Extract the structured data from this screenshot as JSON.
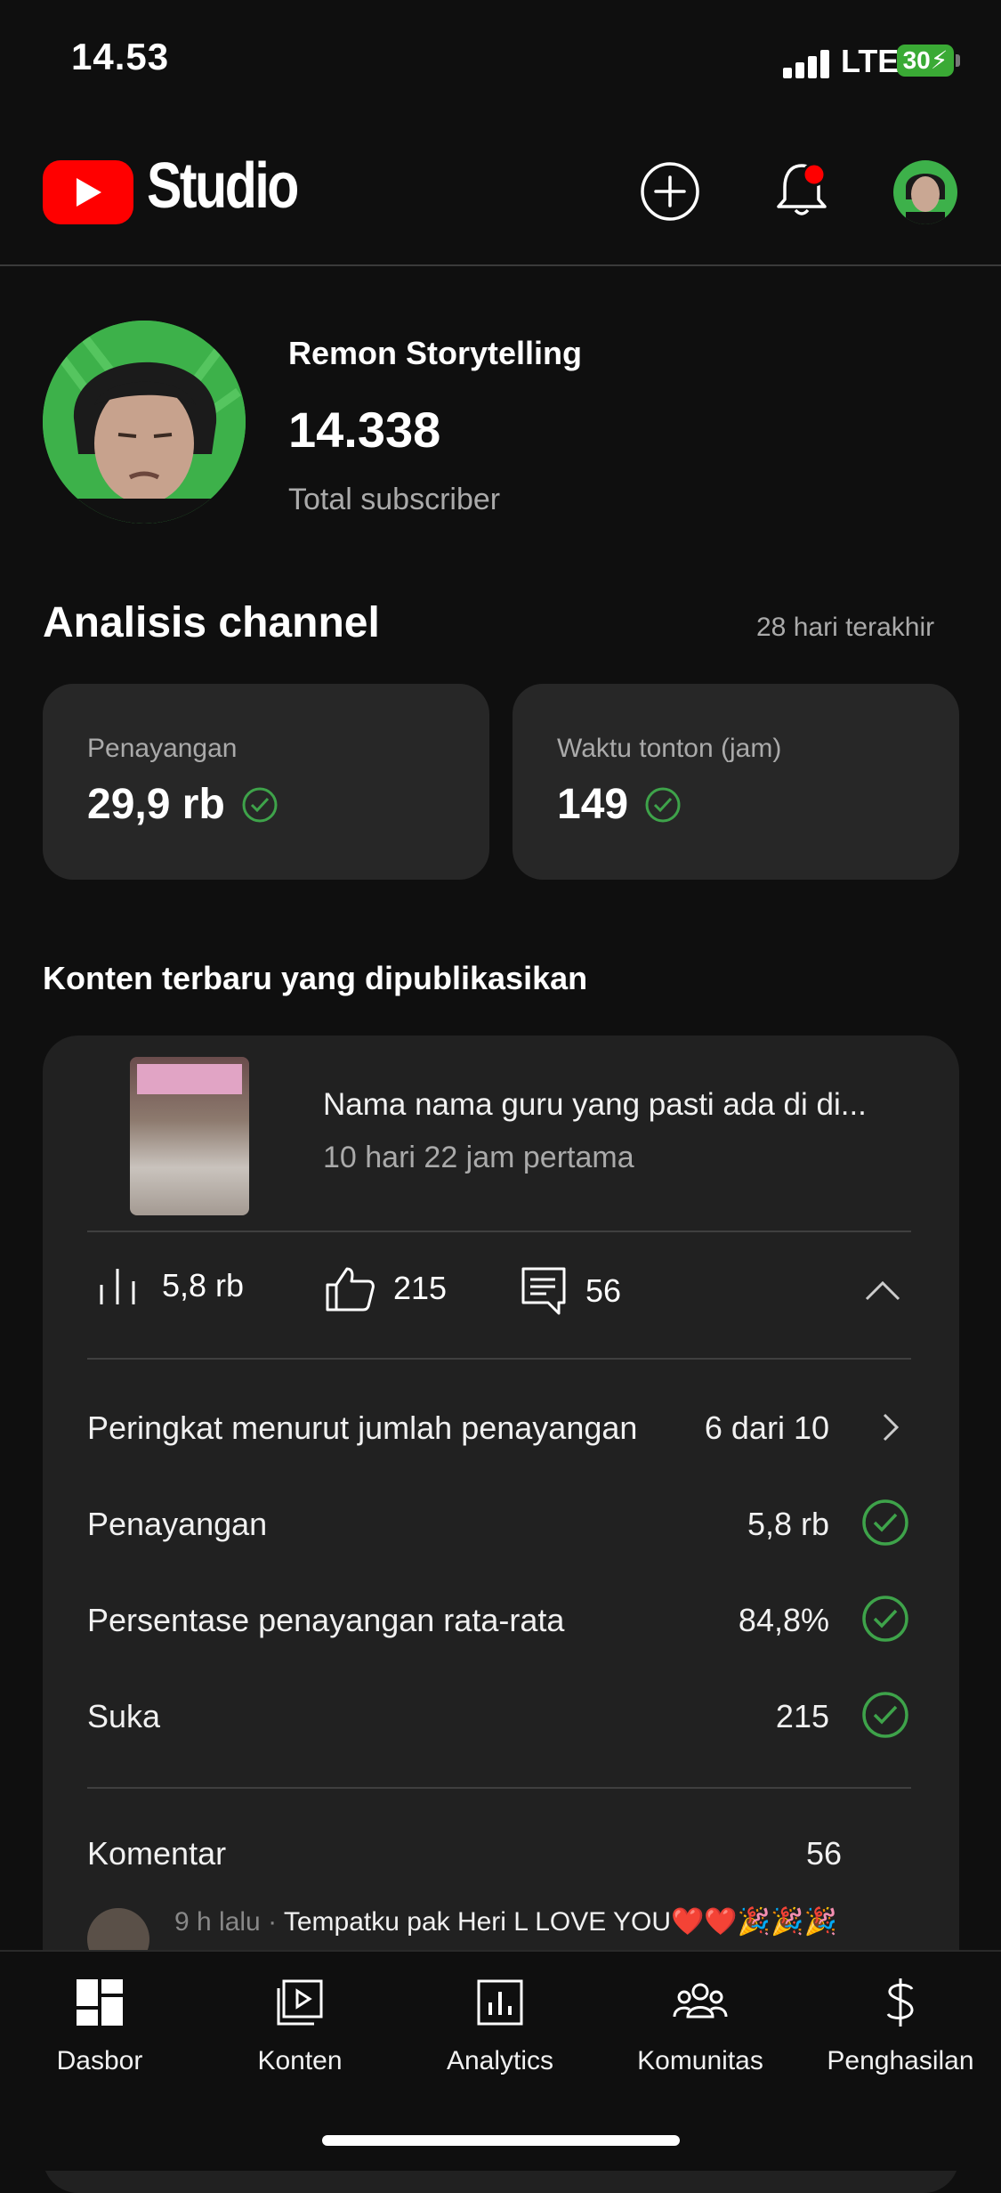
{
  "status_bar": {
    "time": "14.53",
    "network": "LTE",
    "battery": "30"
  },
  "header": {
    "brand": "Studio",
    "icons": [
      "create-icon",
      "notification-bell-icon",
      "profile-avatar"
    ],
    "notification_dot_color": "#ff0000"
  },
  "channel": {
    "name": "Remon Storytelling",
    "subscribers": "14.338",
    "subscribers_label": "Total subscriber"
  },
  "analytics": {
    "title": "Analisis channel",
    "period": "28 hari terakhir",
    "cards": [
      {
        "label": "Penayangan",
        "value": "29,9 rb"
      },
      {
        "label": "Waktu tonton (jam)",
        "value": "149"
      }
    ]
  },
  "recent": {
    "title": "Konten terbaru yang dipublikasikan",
    "video_title": "Nama nama guru yang pasti ada di di...",
    "video_subtitle": "10 hari 22 jam pertama",
    "views": "5,8 rb",
    "likes": "215",
    "comments": "56",
    "rows": [
      {
        "label": "Peringkat menurut jumlah penayangan",
        "value": "6 dari 10"
      },
      {
        "label": "Penayangan",
        "value": "5,8 rb"
      },
      {
        "label": "Persentase penayangan rata-rata",
        "value": "84,8%"
      },
      {
        "label": "Suka",
        "value": "215"
      }
    ],
    "comments_label": "Komentar",
    "comments_value": "56",
    "latest_comment_time": "9 h lalu · ",
    "latest_comment_text": "Tempatku pak Heri L LOVE YOU❤️❤️🎉🎉🎉"
  },
  "bottom_nav": {
    "items": [
      {
        "label": "Dasbor",
        "icon": "dashboard-icon"
      },
      {
        "label": "Konten",
        "icon": "content-icon"
      },
      {
        "label": "Analytics",
        "icon": "analytics-icon"
      },
      {
        "label": "Komunitas",
        "icon": "community-icon"
      },
      {
        "label": "Penghasilan",
        "icon": "earn-icon"
      }
    ]
  },
  "colors": {
    "background": "#0f0f0f",
    "card": "#272727",
    "accent_check": "#3ea34a",
    "youtube_red": "#ff0000"
  }
}
